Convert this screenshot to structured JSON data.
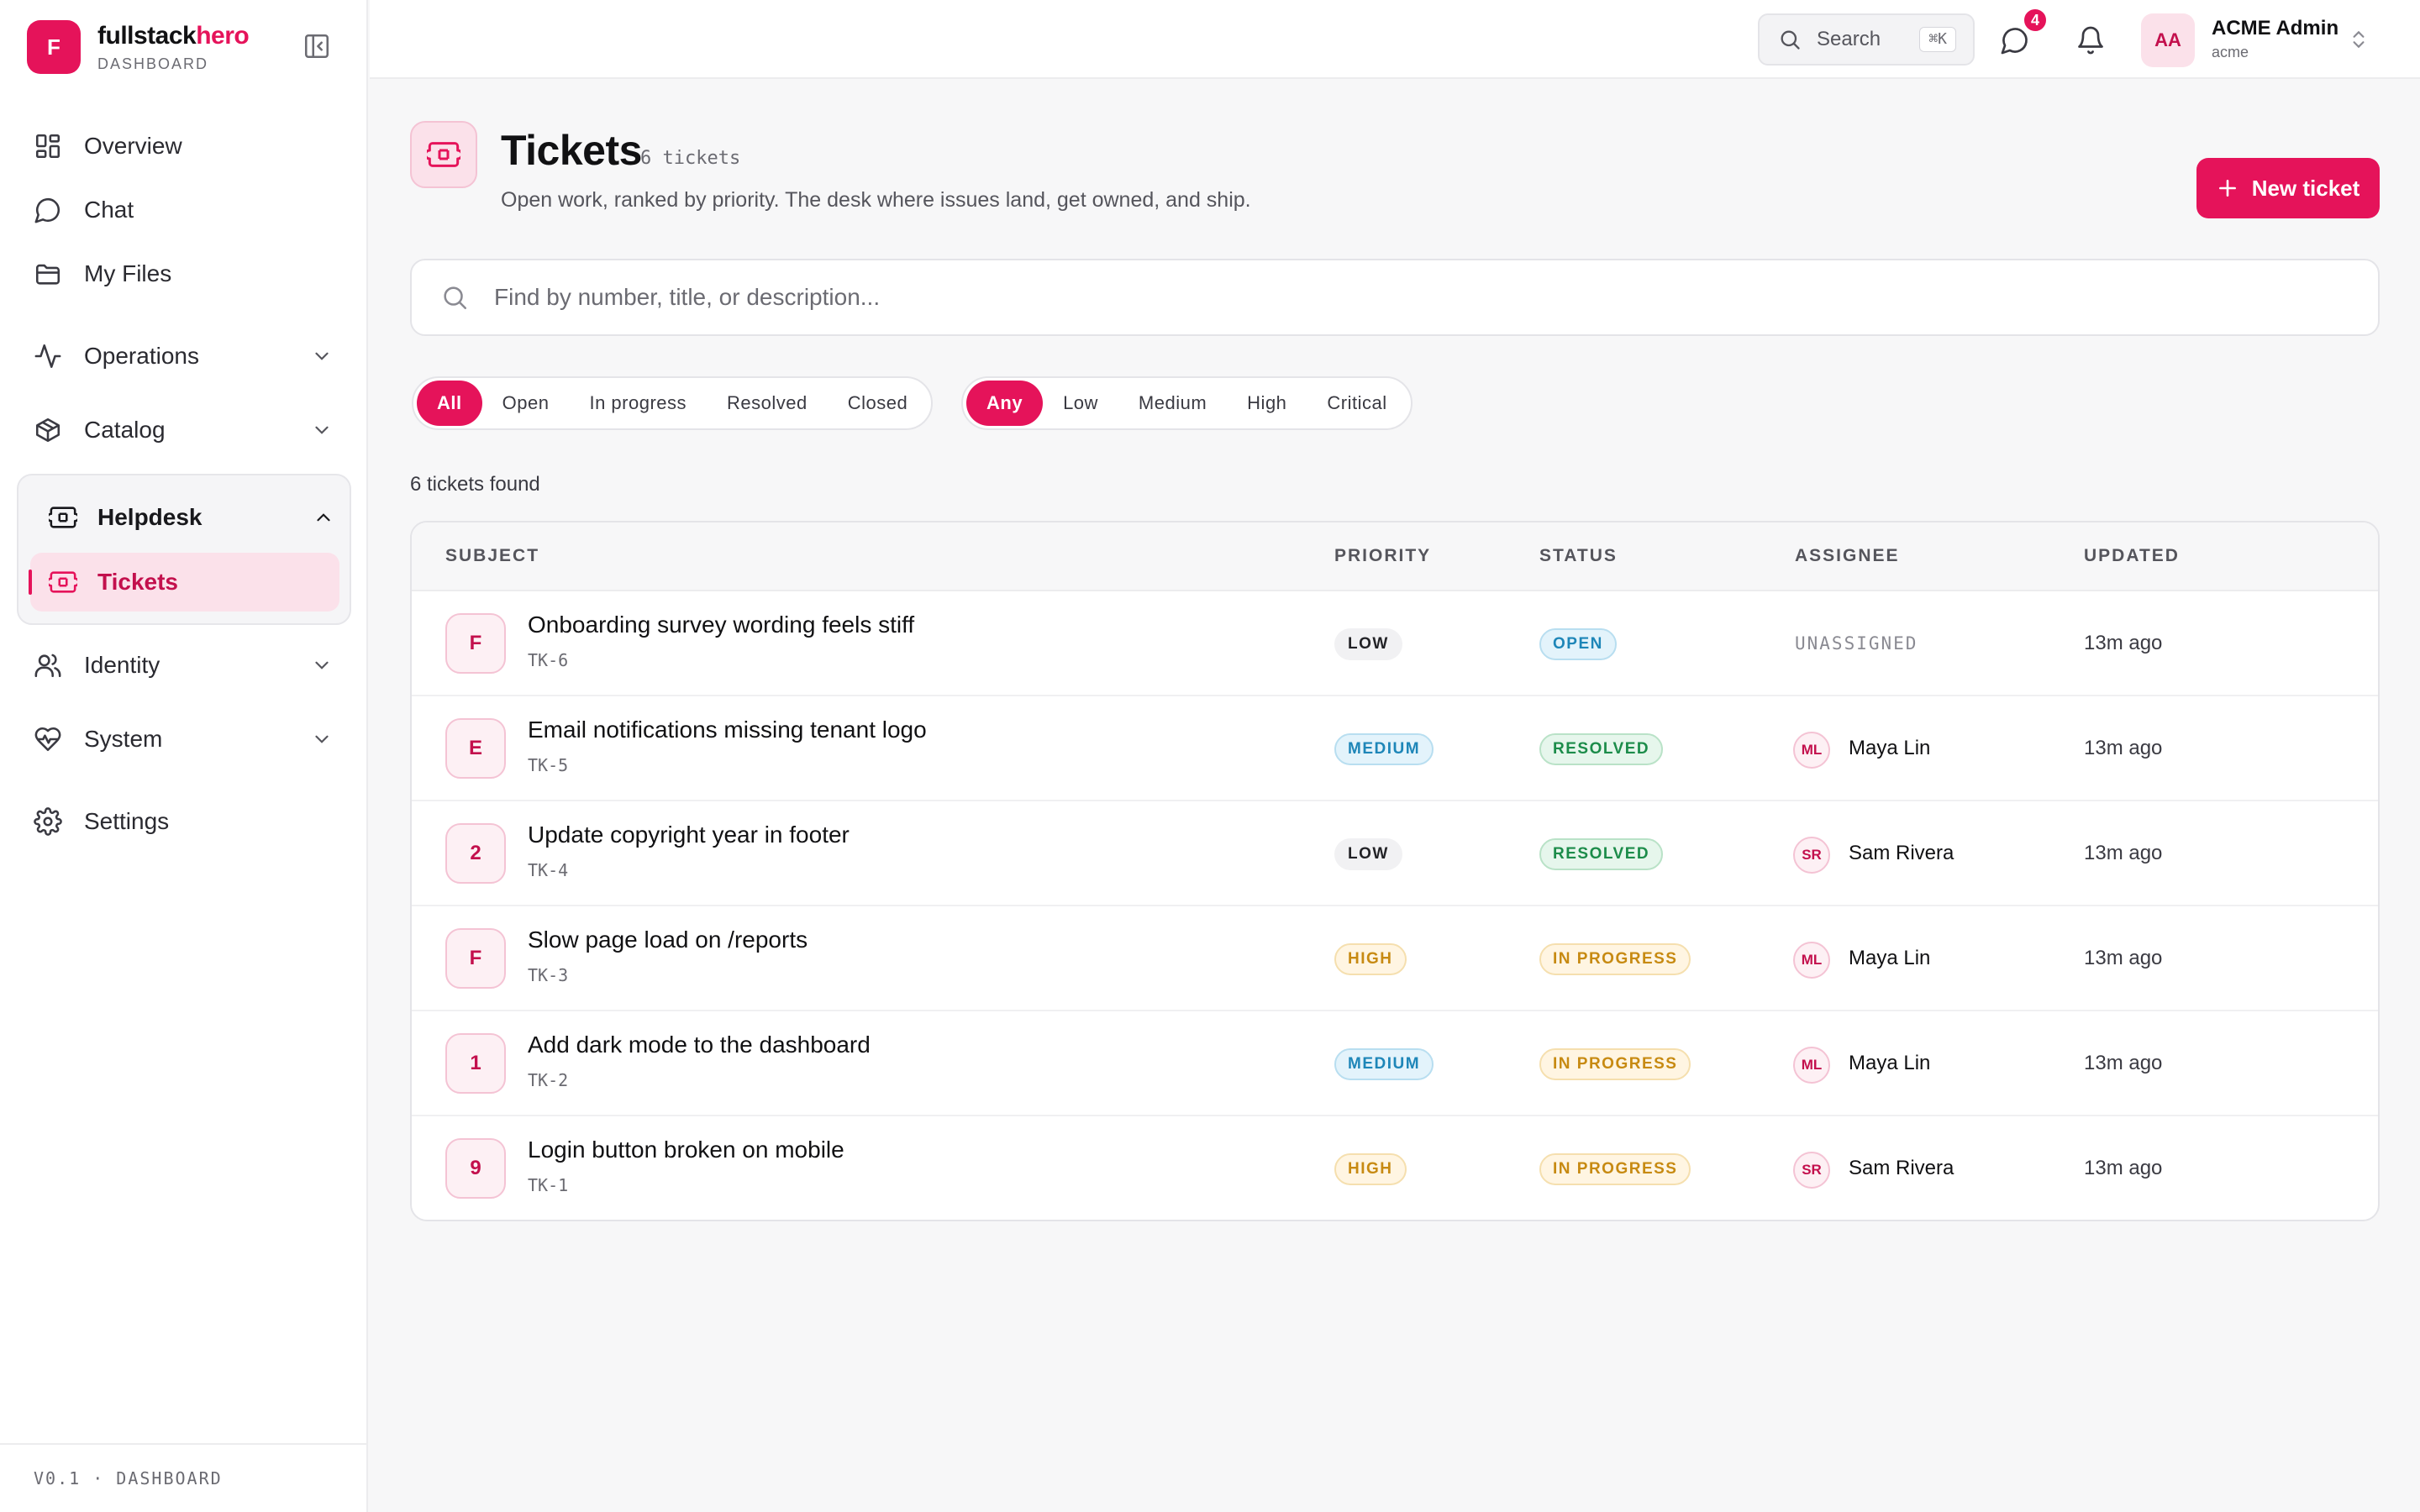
{
  "brand": {
    "initial": "F",
    "name_main": "fullstack",
    "name_accent": "hero",
    "subtitle": "DASHBOARD"
  },
  "sidebar": {
    "items": [
      {
        "label": "Overview",
        "icon": "grid-icon"
      },
      {
        "label": "Chat",
        "icon": "chat-icon"
      },
      {
        "label": "My Files",
        "icon": "folder-icon"
      },
      {
        "label": "Operations",
        "icon": "activity-icon"
      },
      {
        "label": "Catalog",
        "icon": "package-icon"
      },
      {
        "label": "Helpdesk",
        "icon": "ticket-icon"
      },
      {
        "label": "Tickets",
        "icon": "ticket-icon"
      },
      {
        "label": "Identity",
        "icon": "users-icon"
      },
      {
        "label": "System",
        "icon": "heart-pulse-icon"
      },
      {
        "label": "Settings",
        "icon": "gear-icon"
      }
    ],
    "footer": "V0.1 · DASHBOARD"
  },
  "topbar": {
    "search_label": "Search",
    "search_shortcut": "⌘K",
    "chat_badge": "4",
    "user": {
      "initials": "AA",
      "name": "ACME Admin",
      "tenant": "acme"
    }
  },
  "page": {
    "title": "Tickets",
    "count": "6 tickets",
    "description": "Open work, ranked by priority. The desk where issues land, get owned, and ship.",
    "new_button": "New ticket",
    "search_placeholder": "Find by number, title, or description...",
    "found": "6 tickets found"
  },
  "filters": {
    "status": [
      "All",
      "Open",
      "In progress",
      "Resolved",
      "Closed"
    ],
    "status_active": "All",
    "priority": [
      "Any",
      "Low",
      "Medium",
      "High",
      "Critical"
    ],
    "priority_active": "Any"
  },
  "table": {
    "headers": [
      "SUBJECT",
      "PRIORITY",
      "STATUS",
      "ASSIGNEE",
      "UPDATED"
    ],
    "rows": [
      {
        "avatar": "F",
        "title": "Onboarding survey wording feels stiff",
        "id": "TK-6",
        "priority": "LOW",
        "status": "OPEN",
        "assignee_initials": "",
        "assignee": "UNASSIGNED",
        "updated": "13m ago"
      },
      {
        "avatar": "E",
        "title": "Email notifications missing tenant logo",
        "id": "TK-5",
        "priority": "MEDIUM",
        "status": "RESOLVED",
        "assignee_initials": "ML",
        "assignee": "Maya Lin",
        "updated": "13m ago"
      },
      {
        "avatar": "2",
        "title": "Update copyright year in footer",
        "id": "TK-4",
        "priority": "LOW",
        "status": "RESOLVED",
        "assignee_initials": "SR",
        "assignee": "Sam Rivera",
        "updated": "13m ago"
      },
      {
        "avatar": "F",
        "title": "Slow page load on /reports",
        "id": "TK-3",
        "priority": "HIGH",
        "status": "IN PROGRESS",
        "assignee_initials": "ML",
        "assignee": "Maya Lin",
        "updated": "13m ago"
      },
      {
        "avatar": "1",
        "title": "Add dark mode to the dashboard",
        "id": "TK-2",
        "priority": "MEDIUM",
        "status": "IN PROGRESS",
        "assignee_initials": "ML",
        "assignee": "Maya Lin",
        "updated": "13m ago"
      },
      {
        "avatar": "9",
        "title": "Login button broken on mobile",
        "id": "TK-1",
        "priority": "HIGH",
        "status": "IN PROGRESS",
        "assignee_initials": "SR",
        "assignee": "Sam Rivera",
        "updated": "13m ago"
      }
    ]
  },
  "colors": {
    "accent": "#e5135a",
    "accent_soft": "#fbe1ea"
  }
}
